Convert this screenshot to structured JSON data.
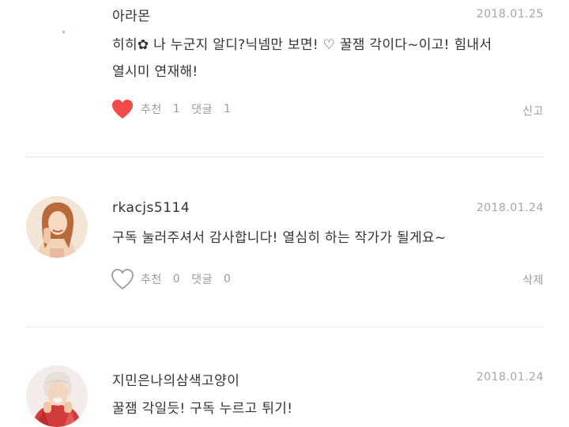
{
  "comments": [
    {
      "username": "아라몬",
      "date": "2018.01.25",
      "lines": [
        "히히✿ 나 누군지 알디?닉넴만 보면! ♡ 꿀잼 각이다~이고! 힘내서",
        "열시미 연재해!"
      ],
      "recommend_label": "추천",
      "recommend_count": "1",
      "reply_label": "댓글",
      "reply_count": "1",
      "right_action": "신고",
      "liked": true
    },
    {
      "username": "rkacjs5114",
      "date": "2018.01.24",
      "lines": [
        "구독 눌러주셔서 감사합니다! 열심히 하는 작가가 될게요~"
      ],
      "recommend_label": "추천",
      "recommend_count": "0",
      "reply_label": "댓글",
      "reply_count": "0",
      "right_action": "삭제",
      "liked": false
    },
    {
      "username": "지민은나의삼색고양이",
      "date": "2018.01.24",
      "lines": [
        "꿀잼 각일듯! 구독 누르고 튀기!"
      ]
    }
  ],
  "colors": {
    "heart_active": "#f04a4a",
    "heart_inactive": "#9a9a9a",
    "divider": "#dcebef",
    "date": "#a6a6a6"
  },
  "icons": [
    "heart-filled-icon",
    "heart-outline-icon"
  ]
}
